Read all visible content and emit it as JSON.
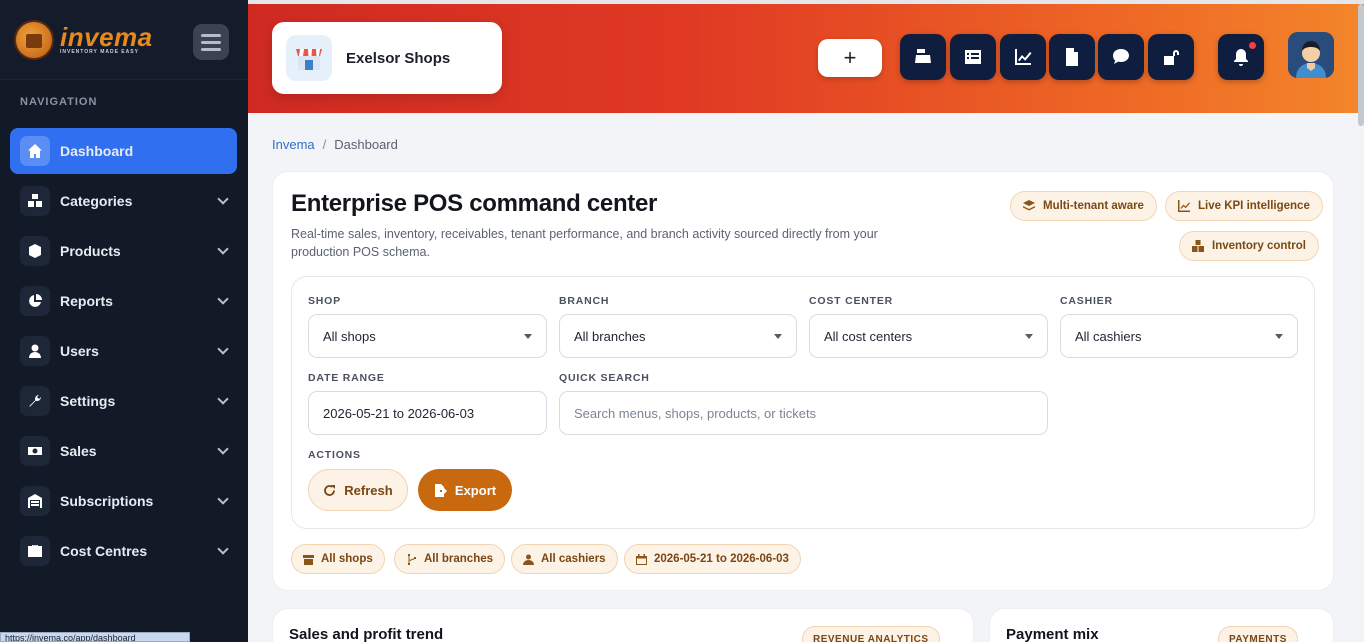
{
  "brand": {
    "name": "invema",
    "tagline": "INVENTORY MADE EASY"
  },
  "sidebar": {
    "section_label": "NAVIGATION",
    "items": [
      {
        "label": "Dashboard",
        "icon": "home-icon",
        "active": true
      },
      {
        "label": "Categories",
        "icon": "cubes-icon"
      },
      {
        "label": "Products",
        "icon": "box-icon"
      },
      {
        "label": "Reports",
        "icon": "pie-chart-icon"
      },
      {
        "label": "Users",
        "icon": "user-icon"
      },
      {
        "label": "Settings",
        "icon": "wrench-icon"
      },
      {
        "label": "Sales",
        "icon": "money-icon"
      },
      {
        "label": "Subscriptions",
        "icon": "warehouse-icon"
      },
      {
        "label": "Cost Centres",
        "icon": "briefcase-icon"
      }
    ]
  },
  "status_url": "https://invema.co/app/dashboard",
  "header": {
    "shop_name": "Exelsor Shops",
    "add_label": "+",
    "actions": [
      "cash-register-icon",
      "list-icon",
      "chart-line-icon",
      "file-icon",
      "comment-icon",
      "unlock-icon"
    ],
    "notification_count": "0"
  },
  "breadcrumb": {
    "root": "Invema",
    "separator": "/",
    "current": "Dashboard"
  },
  "main": {
    "title": "Enterprise POS command center",
    "description": "Real-time sales, inventory, receivables, tenant performance, and branch activity sourced directly from your production POS schema.",
    "badges": [
      "Multi-tenant aware",
      "Live KPI intelligence",
      "Inventory control"
    ],
    "filters": {
      "shop": {
        "label": "SHOP",
        "value": "All shops"
      },
      "branch": {
        "label": "BRANCH",
        "value": "All branches"
      },
      "cost_center": {
        "label": "COST CENTER",
        "value": "All cost centers"
      },
      "cashier": {
        "label": "CASHIER",
        "value": "All cashiers"
      },
      "date_range": {
        "label": "DATE RANGE",
        "value": "2026-05-21 to 2026-06-03"
      },
      "quick_search": {
        "label": "QUICK SEARCH",
        "placeholder": "Search menus, shops, products, or tickets"
      },
      "actions_label": "ACTIONS",
      "refresh_label": "Refresh",
      "export_label": "Export"
    },
    "active_chips": [
      "All shops",
      "All branches",
      "All cashiers",
      "2026-05-21 to 2026-06-03"
    ]
  },
  "cards": [
    {
      "title": "Sales and profit trend",
      "badge": "REVENUE ANALYTICS"
    },
    {
      "title": "Payment mix",
      "badge": "PAYMENTS"
    }
  ],
  "colors": {
    "accent": "#2f6ff0",
    "brand_orange": "#c8690f",
    "sidebar_bg": "#121a28",
    "header_start": "#cf2a22",
    "header_end": "#f3862b"
  }
}
